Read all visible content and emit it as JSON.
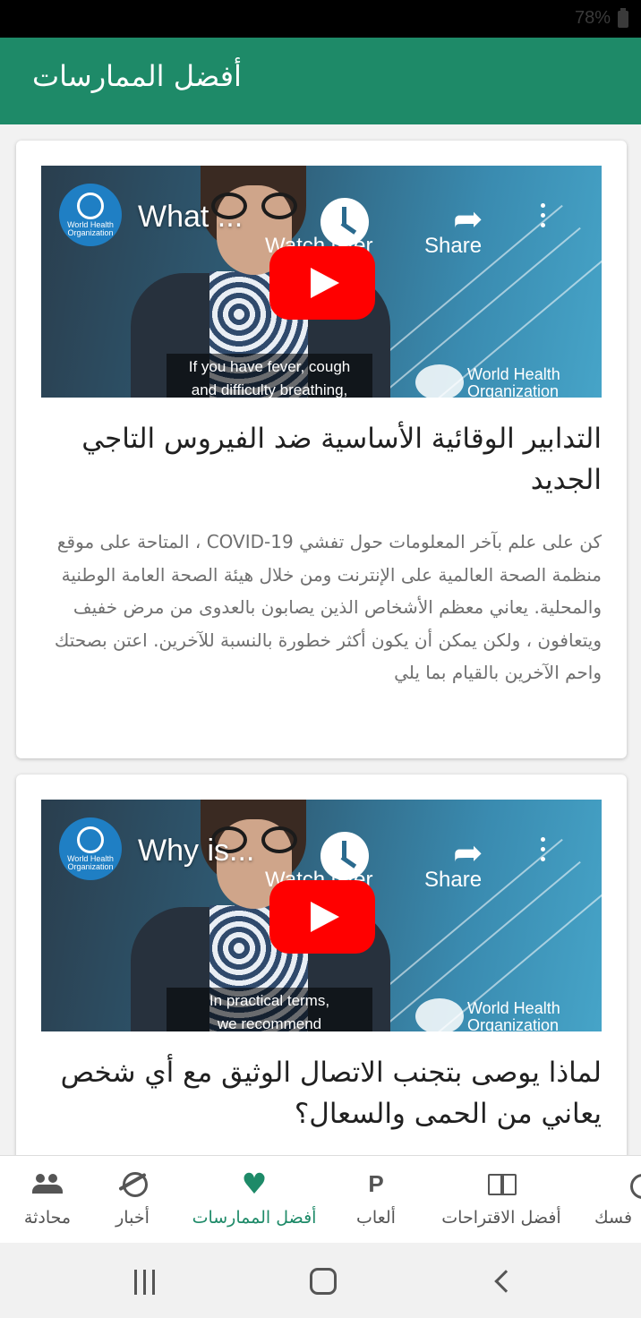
{
  "status_bar": {
    "battery": "78%"
  },
  "app_bar": {
    "title": "أفضل الممارسات"
  },
  "cards": [
    {
      "video": {
        "title": "What ...",
        "watch_later": "Watch later",
        "share": "Share",
        "caption_line1": "If you have fever, cough",
        "caption_line2": "and difficulty breathing,",
        "who_logo_text": "World Health Organization",
        "watermark": "World Health Organization"
      },
      "title": "التدابير الوقائية الأساسية ضد الفيروس التاجي الجديد",
      "body": "كن على علم بآخر المعلومات حول تفشي COVID-19 ، المتاحة على موقع منظمة الصحة العالمية على الإنترنت ومن خلال هيئة الصحة العامة الوطنية والمحلية. يعاني معظم الأشخاص الذين يصابون بالعدوى من مرض خفيف ويتعافون ، ولكن يمكن أن يكون أكثر خطورة بالنسبة للآخرين. اعتن بصحتك واحم الآخرين بالقيام بما يلي"
    },
    {
      "video": {
        "title": "Why is...",
        "watch_later": "Watch later",
        "share": "Share",
        "caption_line1": "In practical terms,",
        "caption_line2": "we recommend",
        "who_logo_text": "World Health Organization",
        "watermark": "World Health Organization"
      },
      "title": "لماذا يوصى بتجنب الاتصال الوثيق مع أي شخص يعاني من الحمى والسعال؟"
    }
  ],
  "bottom_nav": {
    "items": [
      {
        "label": "محادثة",
        "icon": "people-icon"
      },
      {
        "label": "أخبار",
        "icon": "planet-icon"
      },
      {
        "label": "أفضل الممارسات",
        "icon": "heart-icon",
        "active": true
      },
      {
        "label": "ألعاب",
        "icon": "playstation-icon"
      },
      {
        "label": "أفضل الاقتراحات",
        "icon": "book-icon"
      },
      {
        "label": "فسك",
        "icon": "partial-icon"
      }
    ]
  },
  "colors": {
    "primary": "#1e8a68",
    "play_red": "#ff0000"
  }
}
